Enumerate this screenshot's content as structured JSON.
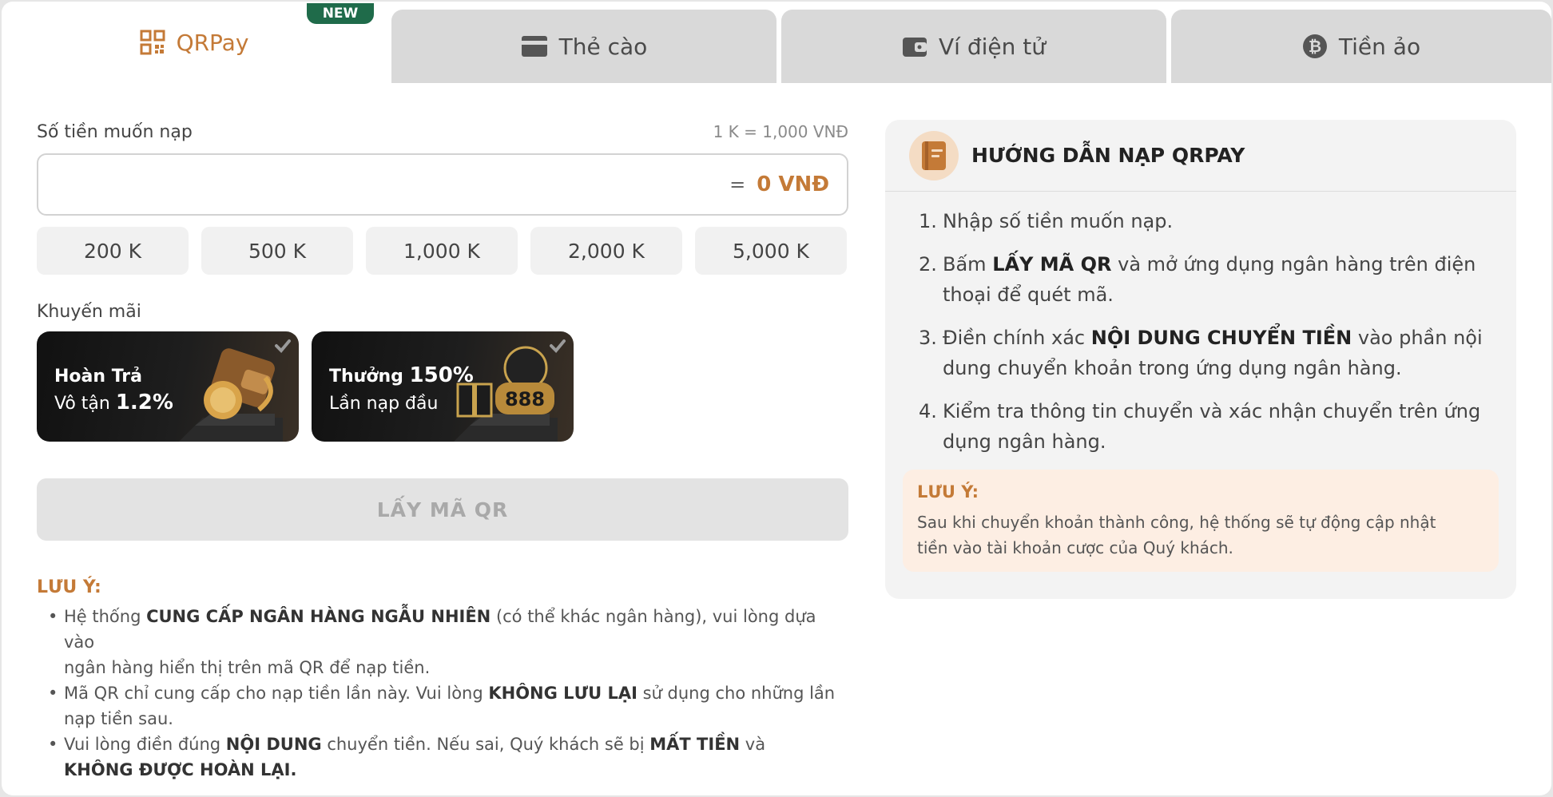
{
  "tabs": [
    {
      "label": "QRPay",
      "icon": "qr-code-icon"
    },
    {
      "label": "Thẻ cào",
      "icon": "card-icon"
    },
    {
      "label": "Ví điện tử",
      "icon": "wallet-icon"
    },
    {
      "label": "Tiền ảo",
      "icon": "bitcoin-icon"
    }
  ],
  "new_badge": "NEW",
  "amount": {
    "label": "Số tiền muốn nạp",
    "rate": "1 K = 1,000 VNĐ",
    "equals": "=",
    "converted": "0 VNĐ",
    "value": ""
  },
  "quick_amounts": [
    "200 K",
    "500 K",
    "1,000 K",
    "2,000 K",
    "5,000 K"
  ],
  "promo": {
    "label": "Khuyến mãi",
    "cards": [
      {
        "line1": "Hoàn Trả",
        "line1_strong": "",
        "line2": "Vô tận ",
        "line2_strong": "1.2%"
      },
      {
        "line1": "Thưởng ",
        "line1_strong": "150%",
        "line2": "Lần nạp đầu",
        "line2_strong": ""
      }
    ]
  },
  "cta_label": "LẤY MÃ QR",
  "note": {
    "title": "LƯU Ý:",
    "items": [
      {
        "parts": [
          "Hệ thống ",
          "CUNG CẤP NGÂN HÀNG NGẪU NHIÊN",
          " (có thể khác ngân hàng), vui lòng dựa vào",
          "ngân hàng hiển thị trên mã QR để nạp tiền."
        ]
      },
      {
        "parts": [
          "Mã QR chỉ cung cấp cho nạp tiền lần này. Vui lòng ",
          "KHÔNG LƯU LẠI",
          " sử dụng cho những lần",
          "nạp tiền sau."
        ]
      },
      {
        "parts": [
          "Vui lòng điền đúng ",
          "NỘI DUNG",
          " chuyển tiền. Nếu sai, Quý khách sẽ bị ",
          "MẤT TIỀN",
          " và",
          "KHÔNG ĐƯỢC HOÀN LẠI."
        ]
      }
    ]
  },
  "guide": {
    "title": "HƯỚNG DẪN NẠP QRPAY",
    "steps": [
      {
        "num": "1.",
        "parts": [
          "Nhập số tiền muốn nạp."
        ]
      },
      {
        "num": "2.",
        "parts": [
          "Bấm ",
          "LẤY MÃ QR",
          " và mở ứng dụng ngân hàng trên điện",
          "thoại để quét mã."
        ]
      },
      {
        "num": "3.",
        "parts": [
          "Điền chính xác ",
          "NỘI DUNG CHUYỂN TIỀN",
          " vào phần nội",
          "dung chuyển khoản trong ứng dụng ngân hàng."
        ]
      },
      {
        "num": "4.",
        "parts": [
          "Kiểm tra thông tin chuyển và xác nhận chuyển trên ứng",
          "dụng ngân hàng."
        ]
      }
    ],
    "warn_title": "LƯU Ý:",
    "warn_lines": [
      "Sau khi chuyển khoản thành công, hệ thống sẽ tự động cập nhật",
      "tiền vào tài khoản cược của Quý khách."
    ]
  },
  "colors": {
    "accent": "#c47a37",
    "badge": "#1f6b4a",
    "tab_inactive": "#d9d9d9"
  }
}
